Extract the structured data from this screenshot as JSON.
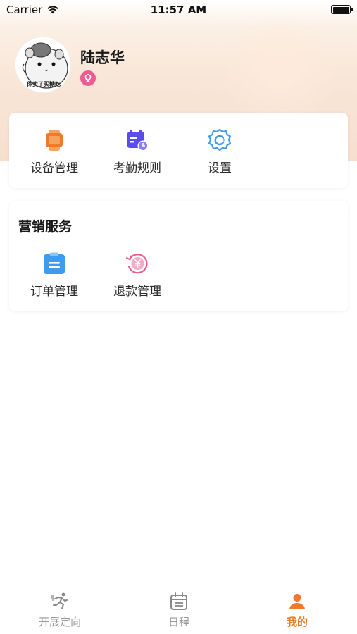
{
  "status_bar": {
    "carrier": "Carrier",
    "time": "11:57 AM"
  },
  "profile": {
    "name": "陆志华",
    "avatar_caption": "你卖了买糖吃",
    "gender": "female",
    "gender_color": "#ef5b8f"
  },
  "tools": {
    "items": [
      {
        "label": "设备管理",
        "icon": "device-watch-icon",
        "color": "#f07a2a"
      },
      {
        "label": "考勤规则",
        "icon": "calendar-clock-icon",
        "color": "#5b4cf0"
      },
      {
        "label": "设置",
        "icon": "gear-icon",
        "color": "#3d9cf0"
      }
    ]
  },
  "marketing": {
    "title": "营销服务",
    "items": [
      {
        "label": "订单管理",
        "icon": "order-clipboard-icon",
        "color": "#3d9cf0"
      },
      {
        "label": "退款管理",
        "icon": "refund-yuan-icon",
        "color": "#ef5b8f"
      }
    ]
  },
  "tab_bar": {
    "items": [
      {
        "label": "开展定向",
        "icon": "runner-icon",
        "active": false
      },
      {
        "label": "日程",
        "icon": "calendar-icon",
        "active": false
      },
      {
        "label": "我的",
        "icon": "person-icon",
        "active": true
      }
    ],
    "active_color": "#f07a2a"
  }
}
